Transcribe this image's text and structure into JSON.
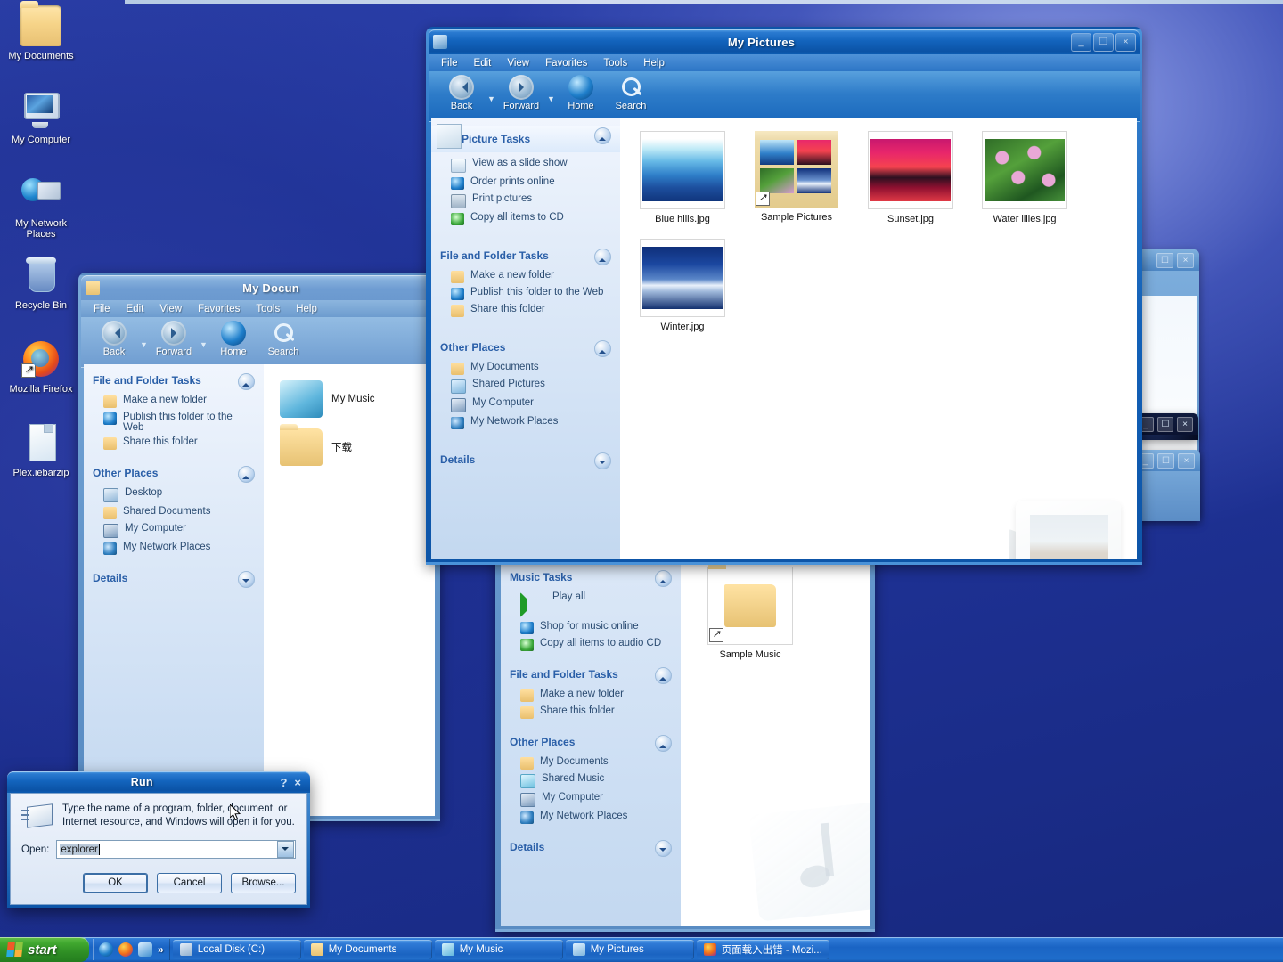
{
  "desktop": {
    "icons": [
      {
        "label": "My Documents",
        "icon": "folder-icon"
      },
      {
        "label": "My Computer",
        "icon": "computer-icon"
      },
      {
        "label": "My Network Places",
        "icon": "network-icon"
      },
      {
        "label": "Recycle Bin",
        "icon": "recycle-bin-icon"
      },
      {
        "label": "Mozilla Firefox",
        "icon": "firefox-icon"
      },
      {
        "label": "Plex.iebarzip",
        "icon": "file-icon"
      }
    ]
  },
  "my_pictures_window": {
    "title": "My Pictures",
    "menus": [
      "File",
      "Edit",
      "View",
      "Favorites",
      "Tools",
      "Help"
    ],
    "toolbar": [
      {
        "label": "Back",
        "icon": "back-icon"
      },
      {
        "label": "Forward",
        "icon": "forward-icon"
      },
      {
        "label": "Home",
        "icon": "home-icon"
      },
      {
        "label": "Search",
        "icon": "search-icon"
      }
    ],
    "buttons": {
      "minimize": "_",
      "maximize": "❐",
      "close": "×"
    },
    "task_panes": [
      {
        "title": "Picture Tasks",
        "items": [
          {
            "label": "View as a slide show",
            "icon": "slideshow-icon"
          },
          {
            "label": "Order prints online",
            "icon": "globe-icon"
          },
          {
            "label": "Print pictures",
            "icon": "printer-icon"
          },
          {
            "label": "Copy all items to CD",
            "icon": "cd-icon"
          }
        ]
      },
      {
        "title": "File and Folder Tasks",
        "items": [
          {
            "label": "Make a new folder",
            "icon": "folder-icon"
          },
          {
            "label": "Publish this folder to the Web",
            "icon": "globe-icon"
          },
          {
            "label": "Share this folder",
            "icon": "folder-icon"
          }
        ]
      },
      {
        "title": "Other Places",
        "items": [
          {
            "label": "My Documents",
            "icon": "folder-icon"
          },
          {
            "label": "Shared Pictures",
            "icon": "pictures-icon"
          },
          {
            "label": "My Computer",
            "icon": "computer-icon"
          },
          {
            "label": "My Network Places",
            "icon": "network-icon"
          }
        ]
      },
      {
        "title": "Details",
        "items": []
      }
    ],
    "files": [
      {
        "name": "Blue hills.jpg",
        "type": "image"
      },
      {
        "name": "Sample Pictures",
        "type": "folder-shortcut"
      },
      {
        "name": "Sunset.jpg",
        "type": "image"
      },
      {
        "name": "Water lilies.jpg",
        "type": "image"
      },
      {
        "name": "Winter.jpg",
        "type": "image"
      }
    ]
  },
  "my_documents_window": {
    "title": "My Docun",
    "menus": [
      "File",
      "Edit",
      "View",
      "Favorites",
      "Tools",
      "Help"
    ],
    "toolbar": [
      {
        "label": "Back",
        "icon": "back-icon"
      },
      {
        "label": "Forward",
        "icon": "forward-icon"
      },
      {
        "label": "Home",
        "icon": "home-icon"
      },
      {
        "label": "Search",
        "icon": "search-icon"
      }
    ],
    "task_panes": [
      {
        "title": "File and Folder Tasks",
        "items": [
          {
            "label": "Make a new folder",
            "icon": "folder-icon"
          },
          {
            "label": "Publish this folder to the Web",
            "icon": "globe-icon"
          },
          {
            "label": "Share this folder",
            "icon": "folder-icon"
          }
        ]
      },
      {
        "title": "Other Places",
        "items": [
          {
            "label": "Desktop",
            "icon": "desktop-icon"
          },
          {
            "label": "Shared Documents",
            "icon": "folder-icon"
          },
          {
            "label": "My Computer",
            "icon": "computer-icon"
          },
          {
            "label": "My Network Places",
            "icon": "network-icon"
          }
        ]
      },
      {
        "title": "Details",
        "items": []
      }
    ],
    "files": [
      {
        "name": "My Music",
        "type": "music-folder"
      },
      {
        "name": "下载",
        "type": "folder"
      }
    ]
  },
  "my_music_window": {
    "task_panes": [
      {
        "title": "Music Tasks",
        "items": [
          {
            "label": "Play all",
            "icon": "play-icon"
          },
          {
            "label": "Shop for music online",
            "icon": "globe-icon"
          },
          {
            "label": "Copy all items to audio CD",
            "icon": "cd-icon"
          }
        ]
      },
      {
        "title": "File and Folder Tasks",
        "items": [
          {
            "label": "Make a new folder",
            "icon": "folder-icon"
          },
          {
            "label": "Share this folder",
            "icon": "folder-icon"
          }
        ]
      },
      {
        "title": "Other Places",
        "items": [
          {
            "label": "My Documents",
            "icon": "folder-icon"
          },
          {
            "label": "Shared Music",
            "icon": "music-icon"
          },
          {
            "label": "My Computer",
            "icon": "computer-icon"
          },
          {
            "label": "My Network Places",
            "icon": "network-icon"
          }
        ]
      },
      {
        "title": "Details",
        "items": []
      }
    ],
    "files": [
      {
        "name": "Sample Music",
        "type": "folder-shortcut"
      }
    ]
  },
  "run_dialog": {
    "title": "Run",
    "help_btn": "?",
    "close_btn": "×",
    "description": "Type the name of a program, folder, document, or Internet resource, and Windows will open it for you.",
    "open_label": "Open:",
    "open_value": "explorer",
    "buttons": {
      "ok": "OK",
      "cancel": "Cancel",
      "browse": "Browse..."
    }
  },
  "taskbar": {
    "start_label": "start",
    "quick_launch": [
      {
        "icon": "internet-explorer-icon"
      },
      {
        "icon": "firefox-icon"
      },
      {
        "icon": "outlook-express-icon"
      }
    ],
    "quick_launch_more": "»",
    "items": [
      {
        "label": "Local Disk (C:)",
        "icon": "disk-icon"
      },
      {
        "label": "My Documents",
        "icon": "folder-icon"
      },
      {
        "label": "My Music",
        "icon": "music-icon"
      },
      {
        "label": "My Pictures",
        "icon": "pictures-icon"
      },
      {
        "label": "页面载入出错 - Mozi...",
        "icon": "firefox-icon"
      }
    ]
  },
  "colors": {
    "titlebar_active": "#0d55a8",
    "titlebar_inactive": "#6b99cf",
    "taskbar": "#1a64c4",
    "start_green": "#2f8f25",
    "desktop_blue": "#1e3194",
    "task_heading": "#2a5fa8"
  }
}
